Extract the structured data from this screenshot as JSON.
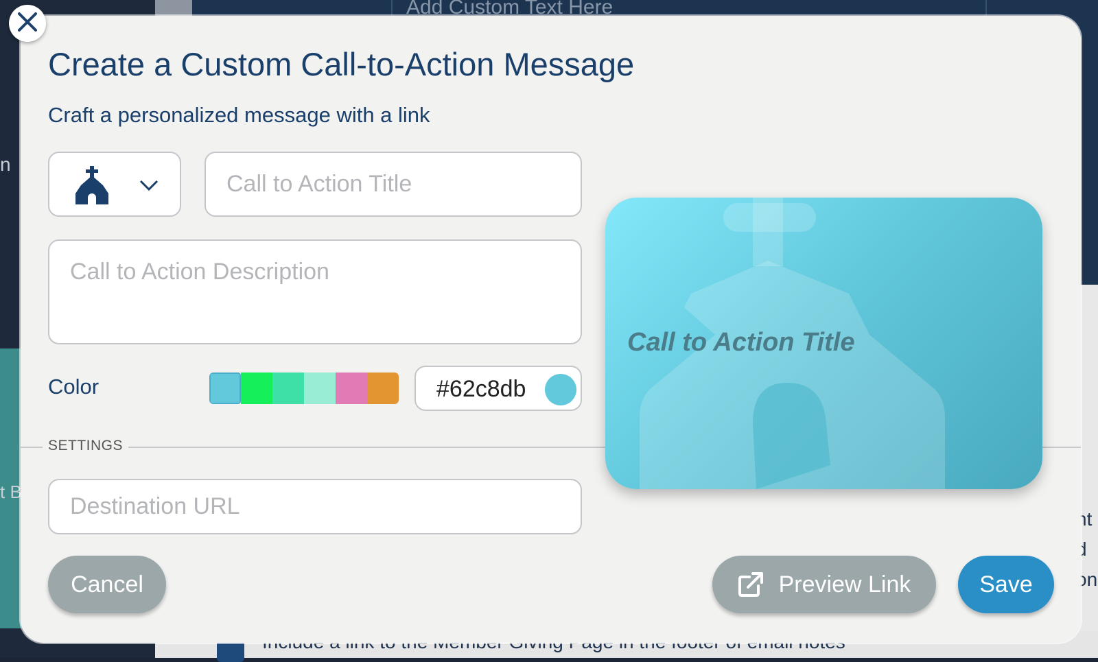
{
  "background": {
    "top_text": "Add Custom Text Here",
    "bottom_text": "Include a link to the Member Giving Page in the footer of email notes",
    "left_letter": "n",
    "left_letter_2": "t B",
    "right_letters": "nt\nd\non"
  },
  "modal": {
    "title": "Create a Custom Call-to-Action Message",
    "subtitle": "Craft a personalized message with a link",
    "icon_select": {
      "selected_icon": "church-icon"
    },
    "title_input": {
      "placeholder": "Call to Action Title",
      "value": ""
    },
    "description_input": {
      "placeholder": "Call to Action Description",
      "value": ""
    },
    "color": {
      "label": "Color",
      "swatches": [
        "#62c8db",
        "#15f05a",
        "#3fe0a8",
        "#98edd4",
        "#e27ab6",
        "#e29530"
      ],
      "selected": "#62c8db",
      "hex_value": "#62c8db"
    },
    "settings_label": "SETTINGS",
    "url_input": {
      "placeholder": "Destination URL",
      "value": ""
    },
    "preview": {
      "title": "Call to Action Title"
    },
    "buttons": {
      "cancel": "Cancel",
      "preview_link": "Preview Link",
      "save": "Save"
    }
  }
}
